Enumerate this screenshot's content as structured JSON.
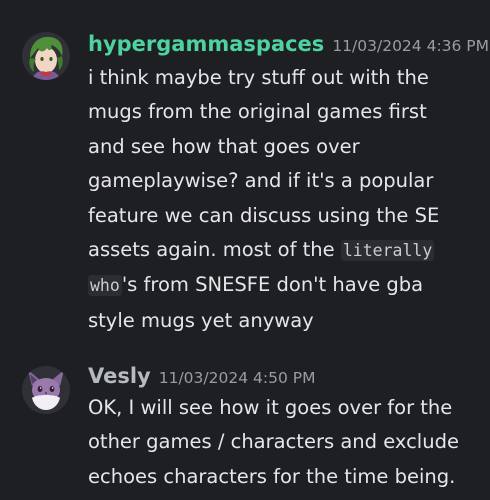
{
  "messages": [
    {
      "username": "hypergammaspaces",
      "timestamp": "11/03/2024 4:36 PM",
      "avatar_icon": "green-haired-character-avatar",
      "lines": {
        "l1": "i think maybe try stuff out with the",
        "l2": "mugs from the original games first",
        "l3": "and see how that goes over",
        "l4": "gameplaywise? and if it's a popular",
        "l5": "feature we can discuss using the SE",
        "l6_text": "assets again. most of the ",
        "l6_code": "literally",
        "l7_code": "who",
        "l7_text": "'s from SNESFE don't have gba",
        "l8": "style mugs yet anyway"
      }
    },
    {
      "username": "Vesly",
      "timestamp": "11/03/2024 4:50 PM",
      "avatar_icon": "eevee-avatar",
      "lines": {
        "l1": "OK, I will see how it goes over for the",
        "l2": "other games / characters and exclude",
        "l3": "echoes characters for the time being."
      }
    }
  ],
  "colors": {
    "background": "#1e1f22",
    "username_1": "#4dd2a0",
    "username_2": "#b5bac1",
    "text": "#e6e6ea",
    "timestamp": "#9a9ca1",
    "code_bg": "#2b2d31"
  }
}
